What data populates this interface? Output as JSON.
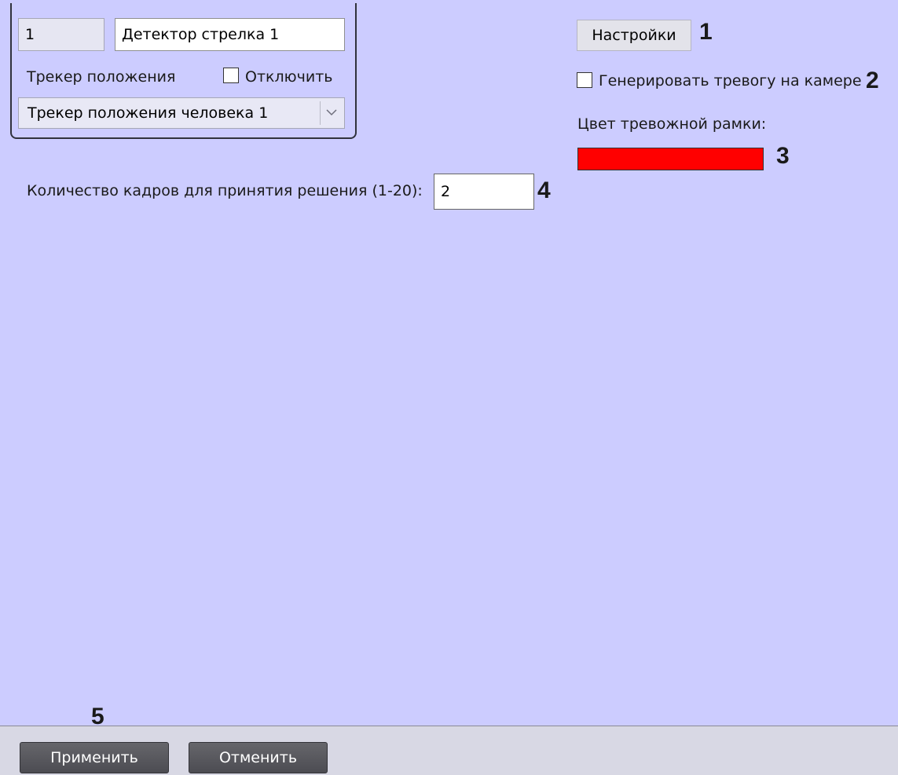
{
  "detector": {
    "id_value": "1",
    "name_value": "Детектор стрелка 1"
  },
  "tracker": {
    "label": "Трекер положения",
    "disable_label": "Отключить",
    "selected": "Трекер положения человека 1"
  },
  "settings": {
    "button_label": "Настройки",
    "alarm_checkbox_label": "Генерировать тревогу на камере",
    "frame_color_label": "Цвет тревожной рамки:",
    "frame_color": "#ff0000",
    "frames_label": "Количество кадров для принятия решения (1-20):",
    "frames_value": "2"
  },
  "markers": {
    "m1": "1",
    "m2": "2",
    "m3": "3",
    "m4": "4",
    "m5": "5"
  },
  "footer": {
    "apply_label": "Применить",
    "cancel_label": "Отменить"
  },
  "colors": {
    "panel_bg": "#ccccff",
    "alarm_red": "#ff0000"
  }
}
